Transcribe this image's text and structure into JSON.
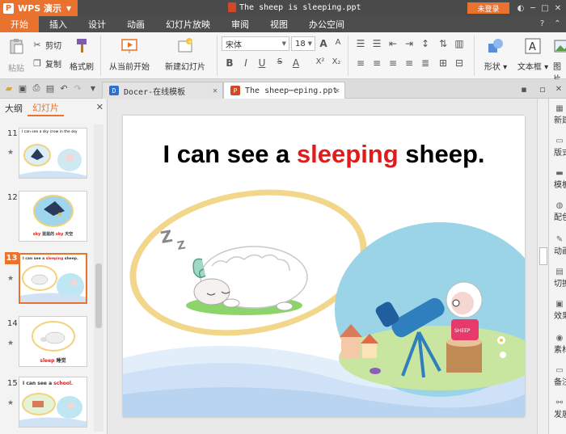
{
  "titlebar": {
    "app_name": "WPS 演示",
    "app_logo": "P",
    "document_title": "The sheep is sleeping.ppt",
    "login_label": "未登录"
  },
  "menubar": {
    "items": [
      "开始",
      "插入",
      "设计",
      "动画",
      "幻灯片放映",
      "审阅",
      "视图",
      "办公空间"
    ]
  },
  "ribbon": {
    "paste": "粘贴",
    "cut": "剪切",
    "copy": "复制",
    "format_painter": "格式刷",
    "from_current": "从当前开始",
    "new_slide": "新建幻灯片",
    "font_name": "宋体",
    "font_size": "18",
    "shapes": "形状",
    "textbox": "文本框",
    "image": "图片"
  },
  "tabs": {
    "tab1": "Docer-在线模板",
    "tab2": "The sheep⋯eping.ppt"
  },
  "leftpanel": {
    "tab_outline": "大纲",
    "tab_slides": "幻灯片",
    "slides": [
      {
        "num": "11",
        "caption": "I can see a sky crow in the sky"
      },
      {
        "num": "12",
        "caption_a": "sky",
        "caption_b": "蓝蓝的",
        "caption_c": "sky",
        "caption_d": "天空"
      },
      {
        "num": "13",
        "caption_a": "I can see a",
        "caption_b": "sleeping",
        "caption_c": "sheep."
      },
      {
        "num": "14",
        "caption_a": "sleep",
        "caption_b": "睡觉"
      },
      {
        "num": "15",
        "caption_a": "I can see a",
        "caption_b": "school."
      }
    ]
  },
  "slide": {
    "title_before": "I can see a ",
    "title_highlight": "sleeping",
    "title_after": " sheep.",
    "shirt_label": "SHEEP"
  },
  "taskpane": {
    "items": [
      "新建",
      "版式",
      "模板",
      "配色",
      "动画",
      "切换",
      "效果",
      "素材",
      "备注",
      "发展"
    ]
  },
  "colors": {
    "accent": "#e8722e",
    "title_red": "#e11b1b"
  }
}
